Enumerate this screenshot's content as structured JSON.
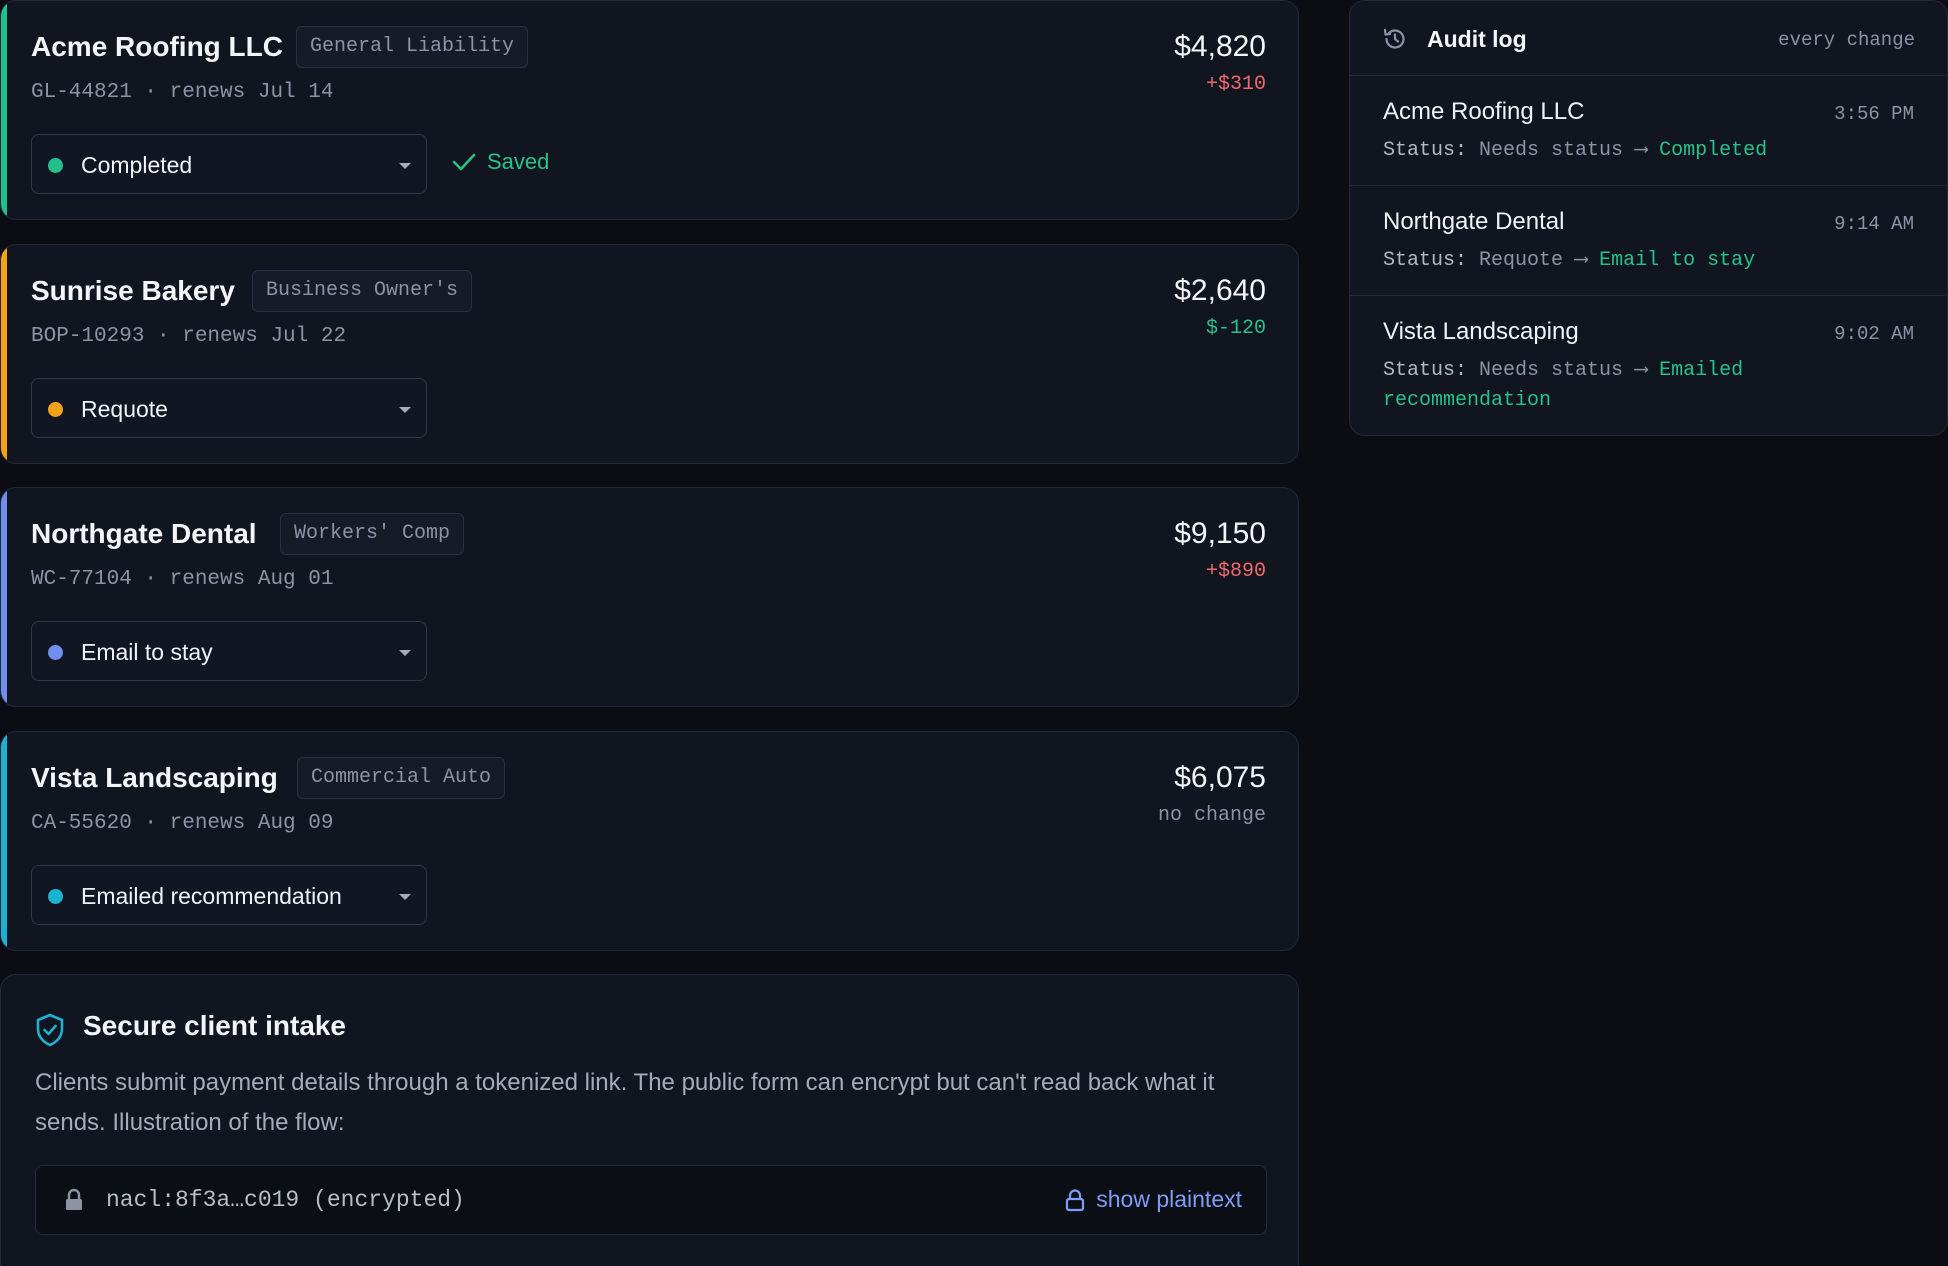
{
  "colors": {
    "completed": "#22c08a",
    "requote": "#f3a21a",
    "email": "#6f8ef0",
    "emailed": "#1cb3d3",
    "increase": "#ef6b6b",
    "decrease": "#28c289",
    "neutral": "#8c93a5",
    "link": "#7f9df4"
  },
  "policies": [
    {
      "name": "Acme Roofing LLC",
      "line": "General Liability",
      "meta": "GL-44821 · renews Jul 14",
      "status": "Completed",
      "premium": "$4,820",
      "delta": "+$310",
      "saved_label": "Saved"
    },
    {
      "name": "Sunrise Bakery",
      "line": "Business Owner's",
      "meta": "BOP-10293 · renews Jul 22",
      "status": "Requote",
      "premium": "$2,640",
      "delta": "$-120"
    },
    {
      "name": "Northgate Dental",
      "line": "Workers' Comp",
      "meta": "WC-77104 · renews Aug 01",
      "status": "Email to stay",
      "premium": "$9,150",
      "delta": "+$890"
    },
    {
      "name": "Vista Landscaping",
      "line": "Commercial Auto",
      "meta": "CA-55620 · renews Aug 09",
      "status": "Emailed recommendation",
      "premium": "$6,075",
      "delta": "no change"
    }
  ],
  "intake": {
    "title": "Secure client intake",
    "description": "Clients submit payment details through a tokenized link. The public form can encrypt but can't read back what it sends. Illustration of the flow:",
    "ciphertext": "nacl:8f3a…c019 (encrypted)",
    "show_plaintext": "show plaintext"
  },
  "audit": {
    "title": "Audit log",
    "subtitle": "every change",
    "entries": [
      {
        "name": "Acme Roofing LLC",
        "time": "3:56 PM",
        "label": "Status:",
        "from": "Needs status",
        "arrow": "⟶",
        "to": "Completed"
      },
      {
        "name": "Northgate Dental",
        "time": "9:14 AM",
        "label": "Status:",
        "from": "Requote",
        "arrow": "⟶",
        "to": "Email to stay"
      },
      {
        "name": "Vista Landscaping",
        "time": "9:02 AM",
        "label": "Status:",
        "from": "Needs status",
        "arrow": "⟶",
        "to": "Emailed recommendation"
      }
    ]
  }
}
